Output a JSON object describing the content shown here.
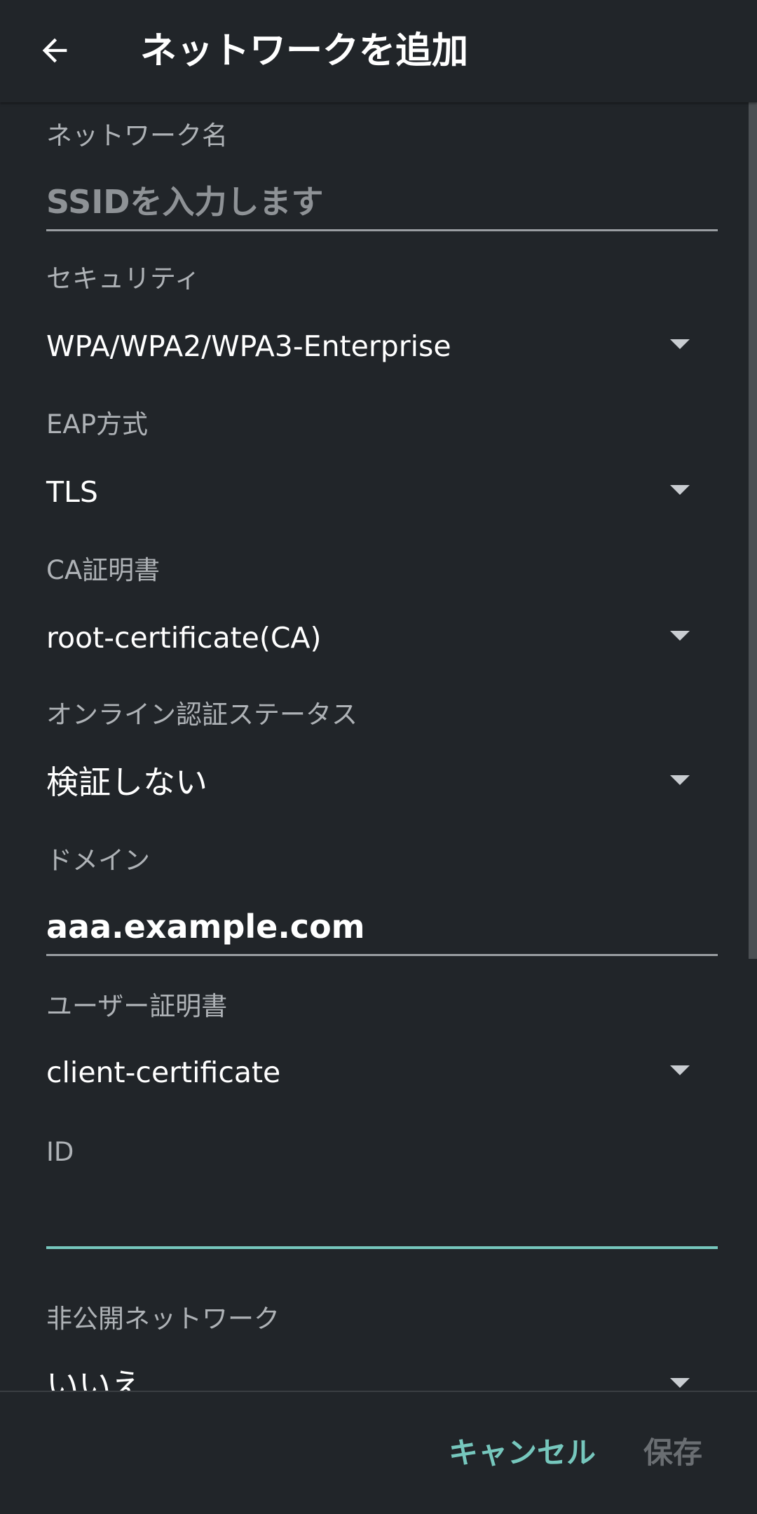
{
  "header": {
    "title": "ネットワークを追加"
  },
  "fields": {
    "network_name": {
      "label": "ネットワーク名",
      "placeholder": "SSIDを入力します"
    },
    "security": {
      "label": "セキュリティ",
      "value": "WPA/WPA2/WPA3-Enterprise"
    },
    "eap": {
      "label": "EAP方式",
      "value": "TLS"
    },
    "ca_cert": {
      "label": "CA証明書",
      "value": "root-certificate(CA)"
    },
    "online_status": {
      "label": "オンライン認証ステータス",
      "value": "検証しない"
    },
    "domain": {
      "label": "ドメイン",
      "value": "aaa.example.com"
    },
    "user_cert": {
      "label": "ユーザー証明書",
      "value": "client-certificate"
    },
    "identity": {
      "label": "ID",
      "value": ""
    },
    "hidden_network": {
      "label": "非公開ネットワーク",
      "value": "いいえ"
    }
  },
  "buttons": {
    "cancel": "キャンセル",
    "save": "保存"
  },
  "colors": {
    "background": "#212529",
    "accent": "#76c7bd",
    "label": "#aeb2b6",
    "disabled": "#6a6e72"
  },
  "icons": {
    "back": "arrow-left-icon",
    "dropdown": "chevron-down-icon"
  }
}
